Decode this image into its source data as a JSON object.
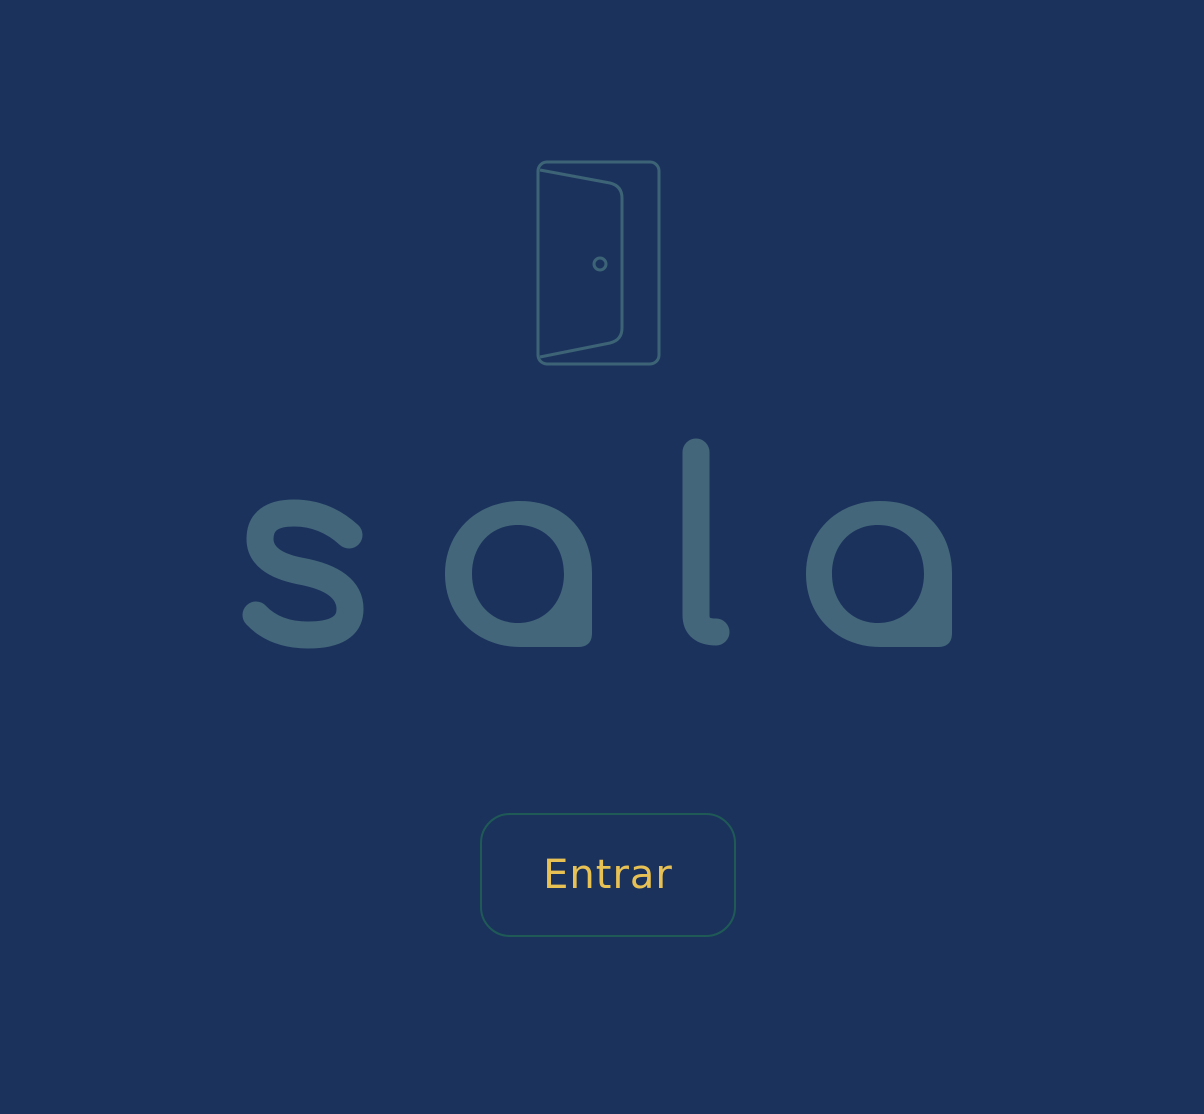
{
  "brand": {
    "name": "sala",
    "icon": "door-icon"
  },
  "actions": {
    "enter_label": "Entrar"
  },
  "colors": {
    "background": "#1b325d",
    "logo": "#43667a",
    "door_outline": "#3d6476",
    "button_border": "#1f5a57",
    "button_text": "#e8c155"
  }
}
